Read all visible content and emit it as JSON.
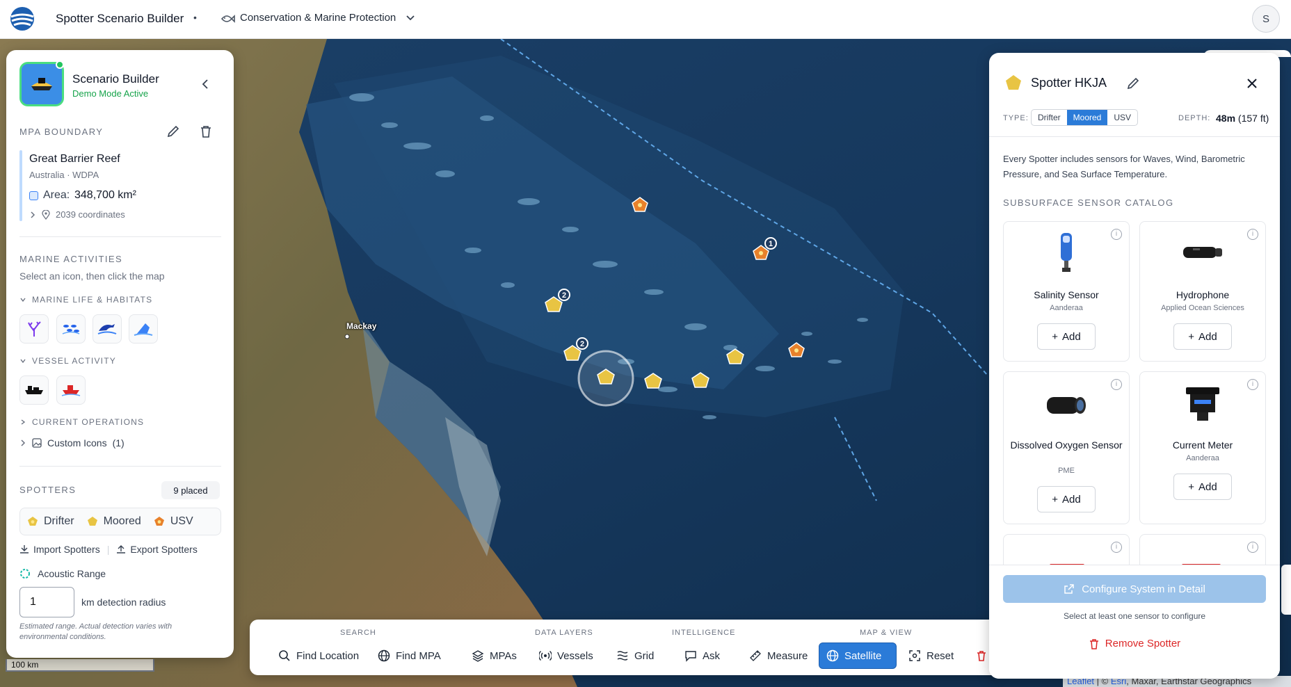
{
  "header": {
    "app_title": "Spotter Scenario Builder",
    "separator": "•",
    "project_name": "Conservation & Marine Protection",
    "avatar_initial": "S"
  },
  "map": {
    "city_label": "Mackay",
    "scale_label": "100 km",
    "attribution": {
      "leaflet": "Leaflet",
      "sep": " | © ",
      "esri": "Esri",
      "rest": ", Maxar, Earthstar Geographics"
    },
    "cluster_labels": [
      "1",
      "2",
      "2"
    ]
  },
  "left_panel": {
    "title": "Scenario Builder",
    "subtitle": "Demo Mode Active",
    "mpa": {
      "section_label": "MPA BOUNDARY",
      "name": "Great Barrier Reef",
      "meta": "Australia · WDPA",
      "area_label": "Area:",
      "area_value": "348,700 km²",
      "coords": "2039 coordinates"
    },
    "activities": {
      "section_label": "MARINE ACTIVITIES",
      "hint": "Select an icon, then click the map",
      "group1": "MARINE LIFE & HABITATS",
      "group2": "VESSEL ACTIVITY",
      "group3": "CURRENT OPERATIONS",
      "custom_label": "Custom Icons",
      "custom_count": "(1)",
      "life_icons": [
        "coral-icon",
        "fish-school-icon",
        "dolphin-icon",
        "ray-icon"
      ],
      "vessel_icons": [
        "cargo-ship-icon",
        "fishing-boat-icon"
      ]
    },
    "spotters": {
      "section_label": "SPOTTERS",
      "placed": "9 placed",
      "legend": [
        "Drifter",
        "Moored",
        "USV"
      ],
      "import_label": "Import Spotters",
      "export_label": "Export Spotters",
      "acoustic_label": "Acoustic Range",
      "radius_value": "1",
      "radius_label": "km detection radius",
      "estimate_note": "Estimated range. Actual detection varies with environmental conditions."
    }
  },
  "toolbar": {
    "groups": [
      "SEARCH",
      "DATA LAYERS",
      "INTELLIGENCE",
      "MAP & VIEW"
    ],
    "buttons": [
      "Find Location",
      "Find MPA",
      "MPAs",
      "Vessels",
      "Grid",
      "Ask",
      "Measure",
      "Satellite",
      "Reset"
    ]
  },
  "right_panel": {
    "title": "Spotter HKJA",
    "type_label": "TYPE:",
    "types": [
      "Drifter",
      "Moored",
      "USV"
    ],
    "selected_type": "Moored",
    "depth_label": "DEPTH:",
    "depth_value": "48m",
    "depth_ft": "(157 ft)",
    "description": "Every Spotter includes sensors for Waves, Wind, Barometric Pressure, and Sea Surface Temperature.",
    "catalog_label": "SUBSURFACE SENSOR CATALOG",
    "sensors": [
      {
        "name": "Salinity Sensor",
        "maker": "Aanderaa",
        "add": "Add"
      },
      {
        "name": "Hydrophone",
        "maker": "Applied Ocean Sciences",
        "add": "Add"
      },
      {
        "name": "Dissolved Oxygen Sensor",
        "maker": "PME",
        "add": "Add"
      },
      {
        "name": "Current Meter",
        "maker": "Aanderaa",
        "add": "Add"
      }
    ],
    "configure_label": "Configure System in Detail",
    "configure_hint": "Select at least one sensor to configure",
    "remove_label": "Remove Spotter"
  },
  "colors": {
    "accent": "#2b7bd8",
    "moored": "#e8c443",
    "usv": "#e8812b",
    "demo_green": "#16a34a",
    "danger": "#dc2626"
  }
}
